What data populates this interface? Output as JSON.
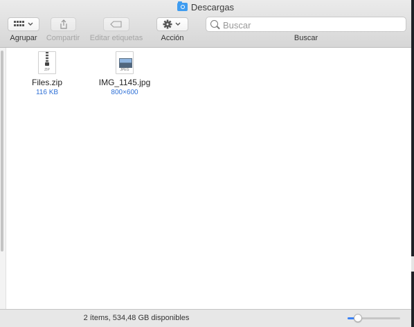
{
  "window": {
    "title": "Descargas"
  },
  "toolbar": {
    "group_label": "Agrupar",
    "share_label": "Compartir",
    "tags_label": "Editar etiquetas",
    "action_label": "Acción",
    "search_label": "Buscar"
  },
  "search": {
    "placeholder": "Buscar"
  },
  "files": [
    {
      "name": "Files.zip",
      "meta": "116 KB",
      "ext": "ZIP",
      "icon": "zip-file-icon"
    },
    {
      "name": "IMG_1145.jpg",
      "meta": "800×600",
      "ext": "JPEG",
      "icon": "jpeg-file-icon"
    }
  ],
  "status": {
    "text": "2 ítems, 534,48 GB disponibles"
  },
  "icon_size_slider": {
    "value": 0.14
  },
  "colors": {
    "accent": "#2d6fd6",
    "slider": "#3b82f6",
    "folder": "#3f9cf0"
  }
}
